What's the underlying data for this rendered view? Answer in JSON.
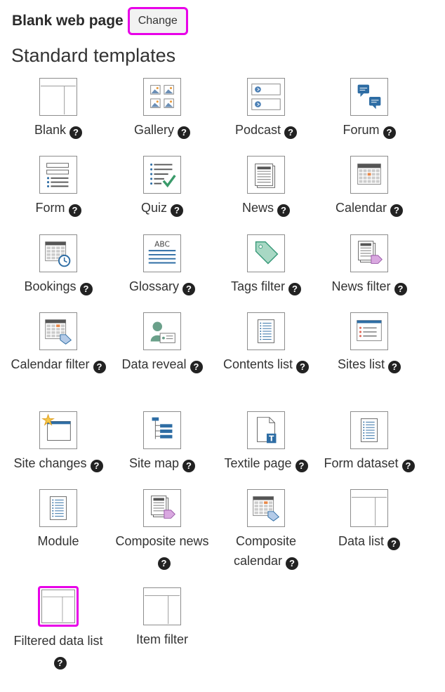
{
  "header": {
    "page_title": "Blank web page",
    "change_label": "Change"
  },
  "section_title": "Standard templates",
  "help_glyph": "?",
  "templates": [
    {
      "label": "Blank",
      "help": true,
      "icon": "blank-layout-icon"
    },
    {
      "label": "Gallery",
      "help": true,
      "icon": "gallery-icon"
    },
    {
      "label": "Podcast",
      "help": true,
      "icon": "podcast-icon"
    },
    {
      "label": "Forum",
      "help": true,
      "icon": "forum-icon"
    },
    {
      "label": "Form",
      "help": true,
      "icon": "form-icon"
    },
    {
      "label": "Quiz",
      "help": true,
      "icon": "quiz-icon"
    },
    {
      "label": "News",
      "help": true,
      "icon": "news-icon"
    },
    {
      "label": "Calendar",
      "help": true,
      "icon": "calendar-icon"
    },
    {
      "label": "Bookings",
      "help": true,
      "icon": "bookings-icon"
    },
    {
      "label": "Glossary",
      "help": true,
      "icon": "glossary-icon"
    },
    {
      "label": "Tags filter",
      "help": true,
      "icon": "tag-icon"
    },
    {
      "label": "News filter",
      "help": true,
      "icon": "news-filter-icon"
    },
    {
      "label": "Calendar filter",
      "help": true,
      "icon": "calendar-filter-icon"
    },
    {
      "label": "Data reveal",
      "help": true,
      "icon": "data-reveal-icon"
    },
    {
      "label": "Contents list",
      "help": true,
      "icon": "contents-list-icon"
    },
    {
      "label": "Sites list",
      "help": true,
      "icon": "sites-list-icon"
    },
    {
      "label": "Site changes",
      "help": true,
      "icon": "site-changes-icon"
    },
    {
      "label": "Site map",
      "help": true,
      "icon": "site-map-icon"
    },
    {
      "label": "Textile page",
      "help": true,
      "icon": "textile-page-icon"
    },
    {
      "label": "Form dataset",
      "help": true,
      "icon": "form-dataset-icon"
    },
    {
      "label": "Module",
      "help": false,
      "icon": "module-icon"
    },
    {
      "label": "Composite news",
      "help": true,
      "icon": "composite-news-icon"
    },
    {
      "label": "Composite calendar",
      "help": true,
      "icon": "composite-calendar-icon"
    },
    {
      "label": "Data list",
      "help": true,
      "icon": "data-list-icon"
    },
    {
      "label": "Filtered data list",
      "help": true,
      "icon": "filtered-data-list-icon"
    },
    {
      "label": "Item filter",
      "help": false,
      "icon": "item-filter-icon"
    }
  ]
}
